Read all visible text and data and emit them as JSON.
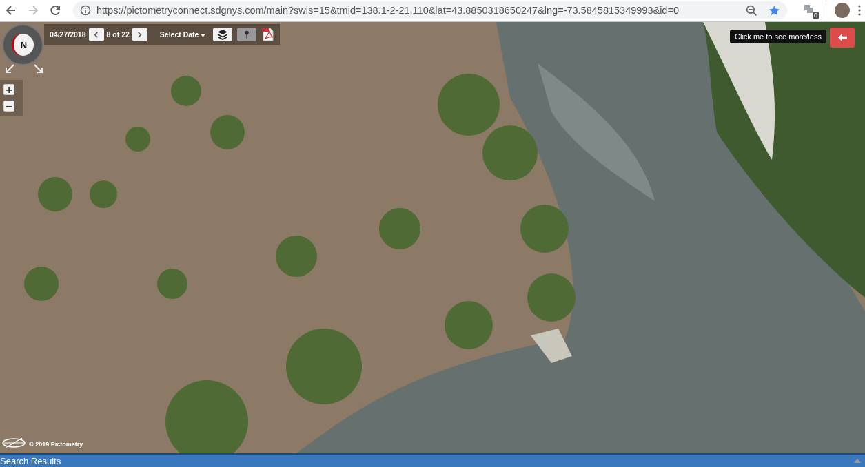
{
  "browser": {
    "url": "https://pictometryconnect.sdgnys.com/main?swis=15&tmid=138.1-2-21.110&lat=43.8850318650247&lng=-73.5845815349993&id=0",
    "extension_badge": "0"
  },
  "map": {
    "compass_label": "N",
    "toolbar": {
      "date": "04/27/2018",
      "page": "8 of 22",
      "select_date": "Select Date"
    },
    "zoom_in": "+",
    "zoom_out": "−",
    "tooltip": "Click me to see more/less",
    "attribution": "© 2019 Pictometry"
  },
  "panel": {
    "title": "Search Results"
  }
}
